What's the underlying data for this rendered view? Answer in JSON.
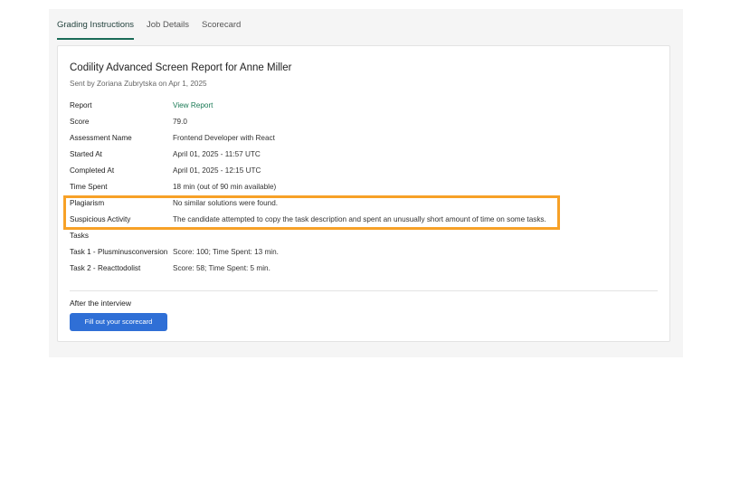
{
  "tabs": [
    {
      "label": "Grading Instructions",
      "active": true
    },
    {
      "label": "Job Details",
      "active": false
    },
    {
      "label": "Scorecard",
      "active": false
    }
  ],
  "report": {
    "title": "Codility Advanced Screen Report for Anne Miller",
    "sent_by": "Sent by Zoriana Zubrytska on Apr 1, 2025",
    "rows": [
      {
        "key": "Report",
        "value": "View Report"
      },
      {
        "key": "Score",
        "value": "79.0"
      },
      {
        "key": "Assessment Name",
        "value": "Frontend Developer with React"
      },
      {
        "key": "Started At",
        "value": "April 01, 2025 - 11:57 UTC"
      },
      {
        "key": "Completed At",
        "value": "April 01, 2025 - 12:15 UTC"
      },
      {
        "key": "Time Spent",
        "value": "18 min (out of 90 min available)"
      },
      {
        "key": "Plagiarism",
        "value": "No similar solutions were found."
      },
      {
        "key": "Suspicious Activity",
        "value": "The candidate attempted to copy the task description and spent an unusually short amount of time on some tasks."
      },
      {
        "key": "Tasks",
        "value": ""
      },
      {
        "key": "Task 1 - Plusminusconversion",
        "value": "Score: 100; Time Spent: 13 min."
      },
      {
        "key": "Task 2 - Reacttodolist",
        "value": "Score: 58; Time Spent: 5 min."
      }
    ]
  },
  "after": {
    "label": "After the interview",
    "button_label": "Fill out your scorecard"
  },
  "colors": {
    "accent_tab": "#1a6b57",
    "link": "#1a7a55",
    "button": "#2f6fd6",
    "highlight": "#f7a127"
  }
}
